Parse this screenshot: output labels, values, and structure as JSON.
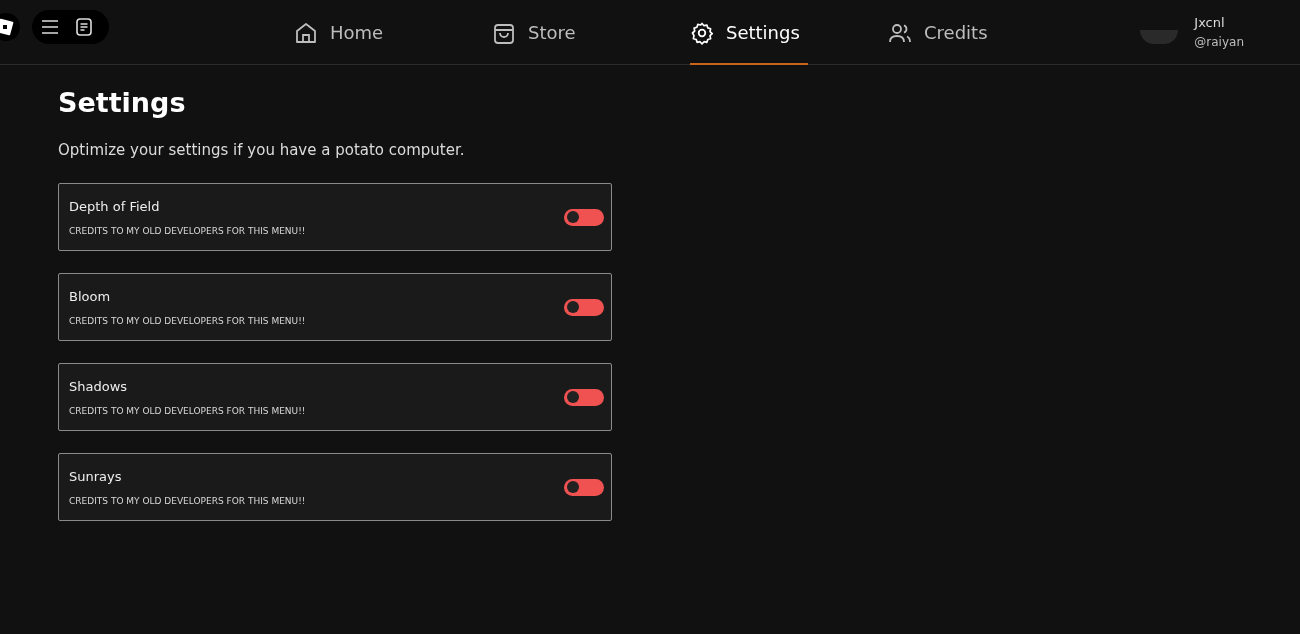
{
  "nav": {
    "tabs": [
      {
        "label": "Home",
        "kind": "home",
        "selected": false
      },
      {
        "label": "Store",
        "kind": "store",
        "selected": false
      },
      {
        "label": "Settings",
        "kind": "settings",
        "selected": true
      },
      {
        "label": "Credits",
        "kind": "credits",
        "selected": false
      }
    ]
  },
  "user": {
    "display_name": "Jxcnl",
    "handle": "@raiyan"
  },
  "page": {
    "title": "Settings",
    "subtitle": "Optimize your settings if you have a potato computer."
  },
  "settings": [
    {
      "name": "Depth of Field",
      "note": "CREDITS TO MY OLD DEVELOPERS FOR THIS MENU!!",
      "on": false
    },
    {
      "name": "Bloom",
      "note": "CREDITS TO MY OLD DEVELOPERS FOR THIS MENU!!",
      "on": false
    },
    {
      "name": "Shadows",
      "note": "CREDITS TO MY OLD DEVELOPERS FOR THIS MENU!!",
      "on": false
    },
    {
      "name": "Sunrays",
      "note": "CREDITS TO MY OLD DEVELOPERS FOR THIS MENU!!",
      "on": false
    }
  ]
}
